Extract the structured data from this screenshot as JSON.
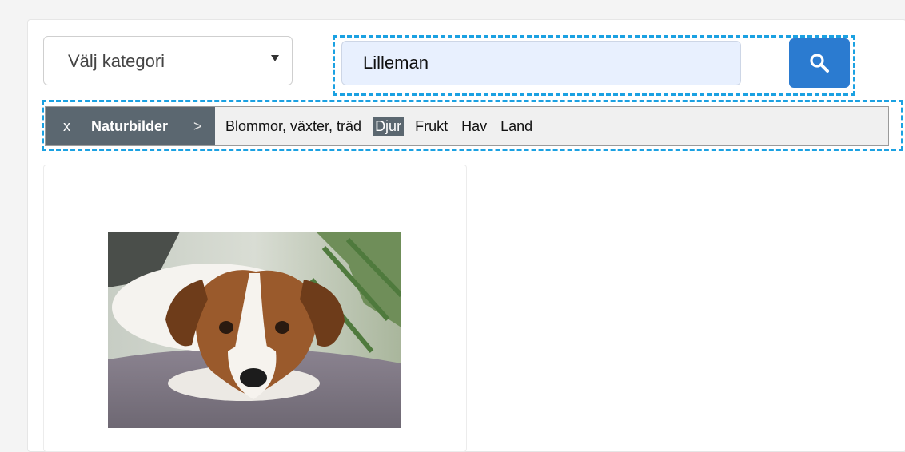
{
  "category_select": {
    "value": "Välj kategori"
  },
  "search": {
    "value": "Lilleman"
  },
  "filter": {
    "clear_label": "x",
    "category": "Naturbilder",
    "separator": ">",
    "subcategories": [
      "Blommor, växter, träd",
      "Djur",
      "Frukt",
      "Hav",
      "Land"
    ],
    "active": "Djur"
  },
  "colors": {
    "accent": "#2b7bd0",
    "highlight": "#1ba1e2",
    "crumb_bg": "#5b6770",
    "search_bg": "#e8f0fe"
  },
  "results": [
    {
      "image": "dog-photo"
    }
  ]
}
